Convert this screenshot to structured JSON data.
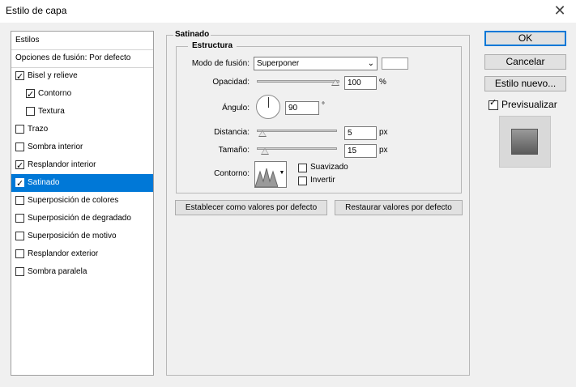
{
  "window": {
    "title": "Estilo de capa",
    "close_glyph": "✕"
  },
  "sidebar": {
    "items": [
      {
        "label": "Estilos",
        "checkbox": false,
        "checked": false
      },
      {
        "label": "Opciones de fusión: Por defecto",
        "checkbox": false,
        "checked": false
      },
      {
        "label": "Bisel y relieve",
        "checkbox": true,
        "checked": true
      },
      {
        "label": "Contorno",
        "checkbox": true,
        "checked": true,
        "indent": true
      },
      {
        "label": "Textura",
        "checkbox": true,
        "checked": false,
        "indent": true
      },
      {
        "label": "Trazo",
        "checkbox": true,
        "checked": false
      },
      {
        "label": "Sombra interior",
        "checkbox": true,
        "checked": false
      },
      {
        "label": "Resplandor interior",
        "checkbox": true,
        "checked": true
      },
      {
        "label": "Satinado",
        "checkbox": true,
        "checked": true,
        "selected": true
      },
      {
        "label": "Superposición de colores",
        "checkbox": true,
        "checked": false
      },
      {
        "label": "Superposición de degradado",
        "checkbox": true,
        "checked": false
      },
      {
        "label": "Superposición de motivo",
        "checkbox": true,
        "checked": false
      },
      {
        "label": "Resplandor exterior",
        "checkbox": true,
        "checked": false
      },
      {
        "label": "Sombra paralela",
        "checkbox": true,
        "checked": false
      }
    ]
  },
  "satin": {
    "title": "Satinado",
    "structure_title": "Estructura",
    "blend_mode_label": "Modo de fusión:",
    "blend_mode_value": "Superponer",
    "blend_color": "#ffffff",
    "opacity_label": "Opacidad:",
    "opacity_value": "100",
    "opacity_unit": "%",
    "opacity_fraction": 1.0,
    "angle_label": "Ángulo:",
    "angle_value": "90",
    "angle_unit": "°",
    "distance_label": "Distancia:",
    "distance_value": "5",
    "distance_unit": "px",
    "distance_fraction": 0.02,
    "size_label": "Tamaño:",
    "size_value": "15",
    "size_unit": "px",
    "size_fraction": 0.06,
    "contour_label": "Contorno:",
    "antialias_label": "Suavizado",
    "antialias_checked": false,
    "invert_label": "Invertir",
    "invert_checked": false,
    "set_default_label": "Establecer como valores por defecto",
    "reset_default_label": "Restaurar valores por defecto"
  },
  "actions": {
    "ok_label": "OK",
    "cancel_label": "Cancelar",
    "new_style_label": "Estilo nuevo...",
    "preview_label": "Previsualizar",
    "preview_checked": true
  },
  "colors": {
    "selection": "#0078d7",
    "accent": "#0078d7"
  }
}
